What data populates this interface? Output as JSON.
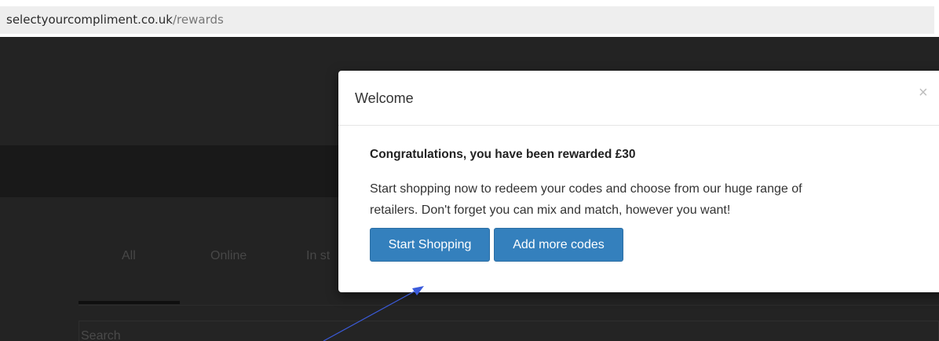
{
  "browser": {
    "url_domain": "selectyourcompliment.co.uk",
    "url_path": "/rewards"
  },
  "site": {
    "tabs": [
      "All",
      "Online",
      "In st"
    ],
    "search_placeholder": "Search"
  },
  "modal": {
    "title": "Welcome",
    "close_glyph": "×",
    "heading": "Congratulations, you have been rewarded £30",
    "body_line1": "Start shopping now to redeem your codes and choose from our huge range of",
    "body_line2": "retailers. Don't forget you can mix and match, however you want!",
    "primary_button": "Start Shopping",
    "secondary_button": "Add more codes"
  },
  "colors": {
    "button_blue": "#3480bd",
    "overlay_dark": "#232323",
    "annotation_arrow": "#3b5bdb"
  },
  "icons": {
    "close": "close-icon",
    "annotation": "annotation-arrow"
  }
}
